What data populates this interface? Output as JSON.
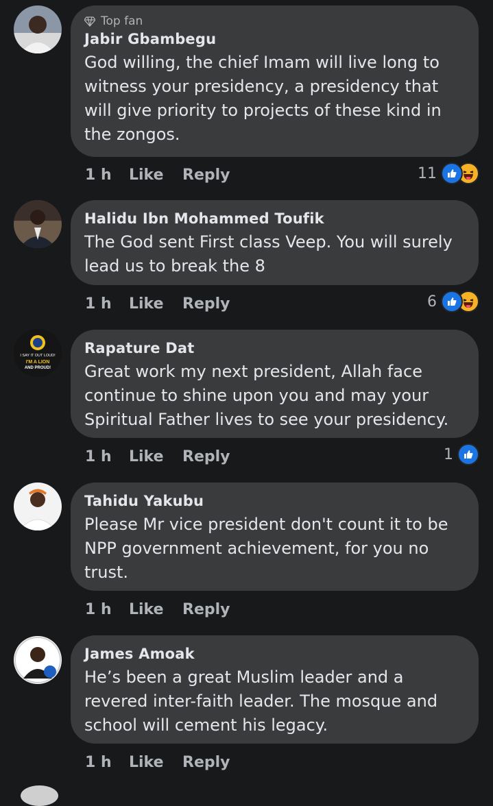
{
  "comments": [
    {
      "badge": "Top fan",
      "author": "Jabir Gbambegu",
      "text": "God willing, the chief Imam will live long to witness your presidency, a presidency that will give priority to projects of these kind in the zongos.",
      "time": "1 h",
      "like": "Like",
      "reply": "Reply",
      "reaction_count": "11",
      "reactions": [
        "like-icon",
        "haha-icon"
      ]
    },
    {
      "author": "Halidu Ibn Mohammed Toufik",
      "text": "The God  sent First class Veep. You will surely lead us to break the 8",
      "time": "1 h",
      "like": "Like",
      "reply": "Reply",
      "reaction_count": "6",
      "reactions": [
        "like-icon",
        "haha-icon"
      ]
    },
    {
      "author": "Rapature Dat",
      "text": "Great work my next president, Allah face continue to shine upon you and may your Spiritual Father lives to see your presidency.",
      "time": "1 h",
      "like": "Like",
      "reply": "Reply",
      "reaction_count": "1",
      "reactions": [
        "like-icon"
      ]
    },
    {
      "author": "Tahidu Yakubu",
      "text": "Please Mr vice president don't count it to be NPP government achievement, for you no trust.",
      "time": "1 h",
      "like": "Like",
      "reply": "Reply"
    },
    {
      "author": "James Amoak",
      "text": "He’s been a great Muslim leader and a revered inter-faith leader. The mosque and school will cement his legacy.",
      "time": "1 h",
      "like": "Like",
      "reply": "Reply"
    }
  ],
  "avatar_badges": {
    "rapature": [
      "I SAY IT OUT LOUD!",
      "I'M A LION",
      "AND PROUD!"
    ]
  },
  "colors": {
    "background": "#18191a",
    "bubble": "#3a3b3c",
    "like_blue": "#1b74e4",
    "haha_yellow": "#f7b125",
    "secondary_text": "#b0b3b8"
  }
}
